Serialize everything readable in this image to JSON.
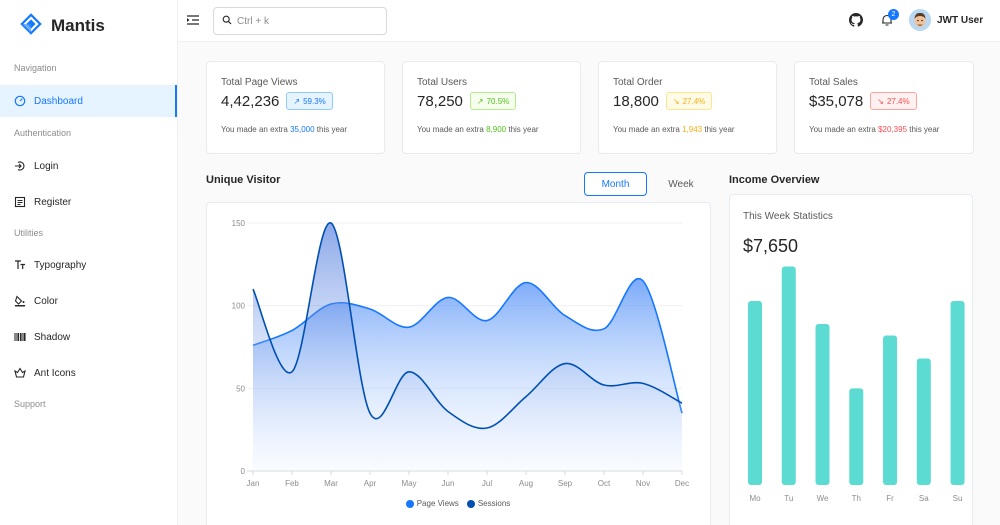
{
  "brand": {
    "name": "Mantis"
  },
  "header": {
    "search_placeholder": "Ctrl + k",
    "notification_count": "2",
    "user_name": "JWT User"
  },
  "sidebar": {
    "groups": [
      "Navigation",
      "Authentication",
      "Utilities",
      "Support"
    ],
    "items": [
      {
        "label": "Dashboard",
        "icon": "dashboard-icon",
        "active": true
      },
      {
        "label": "Login",
        "icon": "login-icon"
      },
      {
        "label": "Register",
        "icon": "register-icon"
      },
      {
        "label": "Typography",
        "icon": "typography-icon"
      },
      {
        "label": "Color",
        "icon": "color-icon"
      },
      {
        "label": "Shadow",
        "icon": "shadow-icon"
      },
      {
        "label": "Ant Icons",
        "icon": "ant-icons-icon"
      }
    ]
  },
  "stats": [
    {
      "title": "Total Page Views",
      "value": "4,42,236",
      "percent": "59.3%",
      "trend": "up",
      "color": "#1677ff",
      "note_prefix": "You made an extra ",
      "note_amount": "35,000",
      "note_suffix": " this year"
    },
    {
      "title": "Total Users",
      "value": "78,250",
      "percent": "70.5%",
      "trend": "up",
      "color": "#52c41a",
      "note_prefix": "You made an extra ",
      "note_amount": "8,900",
      "note_suffix": " this year"
    },
    {
      "title": "Total Order",
      "value": "18,800",
      "percent": "27.4%",
      "trend": "down",
      "color": "#faad14",
      "note_prefix": "You made an extra ",
      "note_amount": "1,943",
      "note_suffix": " this year"
    },
    {
      "title": "Total Sales",
      "value": "$35,078",
      "percent": "27.4%",
      "trend": "down",
      "color": "#ff4d4f",
      "note_prefix": "You made an extra ",
      "note_amount": "$20,395",
      "note_suffix": " this year"
    }
  ],
  "unique_visitor": {
    "title": "Unique Visitor",
    "toggle": {
      "month": "Month",
      "week": "Week",
      "selected": "Month"
    }
  },
  "income": {
    "title": "Income Overview",
    "subtitle": "This Week Statistics",
    "value": "$7,650"
  },
  "chart_data": [
    {
      "type": "area",
      "categories": [
        "Jan",
        "Feb",
        "Mar",
        "Apr",
        "May",
        "Jun",
        "Jul",
        "Aug",
        "Sep",
        "Oct",
        "Nov",
        "Dec"
      ],
      "series": [
        {
          "name": "Page Views",
          "values": [
            76,
            85,
            101,
            98,
            87,
            105,
            91,
            114,
            94,
            86,
            115,
            35
          ],
          "color": "#1677ff"
        },
        {
          "name": "Sessions",
          "values": [
            110,
            60,
            150,
            35,
            60,
            36,
            26,
            45,
            65,
            52,
            53,
            41
          ],
          "color": "#0050b3"
        }
      ],
      "yticks": [
        0,
        50,
        100,
        150
      ],
      "ylim": [
        0,
        150
      ],
      "grid": true,
      "legend": "bottom"
    },
    {
      "type": "bar",
      "categories": [
        "Mo",
        "Tu",
        "We",
        "Th",
        "Fr",
        "Sa",
        "Su"
      ],
      "values": [
        80,
        95,
        70,
        42,
        65,
        55,
        80
      ],
      "color": "#5cdbd3",
      "ylim": [
        0,
        100
      ]
    }
  ]
}
